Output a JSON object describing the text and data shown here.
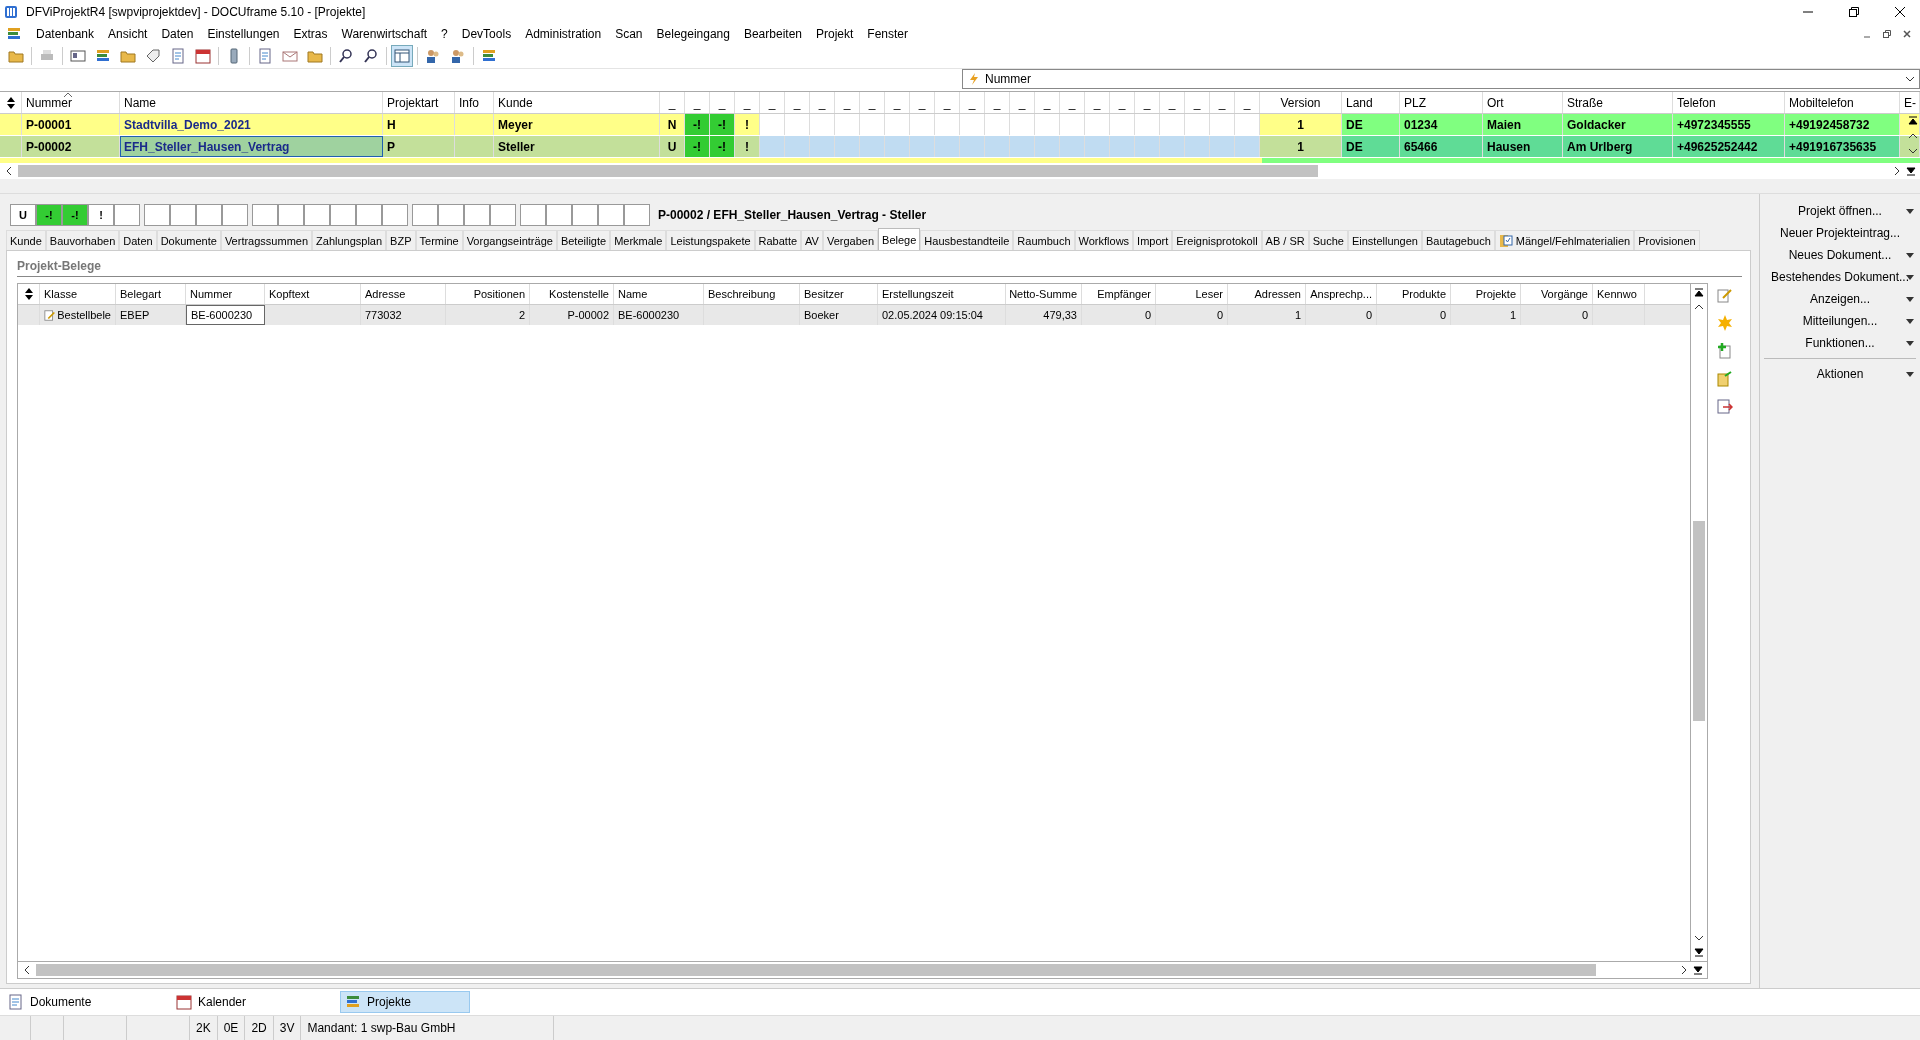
{
  "window": {
    "title": "DFViProjektR4 [swpviprojektdev] - DOCUframe 5.10 - [Projekte]"
  },
  "menu": [
    "Datenbank",
    "Ansicht",
    "Daten",
    "Einstellungen",
    "Extras",
    "Warenwirtschaft",
    "?",
    "DevTools",
    "Administration",
    "Scan",
    "Belegeingang",
    "Bearbeiten",
    "Projekt",
    "Fenster"
  ],
  "filter": {
    "value": "Nummer"
  },
  "projects": {
    "columns": [
      "Nummer",
      "Name",
      "Projektart",
      "Info",
      "Kunde",
      "Version",
      "Land",
      "PLZ",
      "Ort",
      "Straße",
      "Telefon",
      "Mobiltelefon",
      "E-"
    ],
    "flag_headers": [
      "_",
      "_",
      "_",
      "_",
      "_",
      "_",
      "_",
      "_",
      "_",
      "_",
      "_",
      "_",
      "_",
      "_",
      "_",
      "_",
      "_",
      "_",
      "_",
      "_",
      "_",
      "_",
      "_",
      "_"
    ],
    "rows": [
      {
        "selected": false,
        "nummer": "P-00001",
        "name": "Stadtvilla_Demo_2021",
        "projektart": "H",
        "info": null,
        "kunde": "Meyer",
        "flags": [
          {
            "text": "N",
            "color": "#ffff88"
          },
          {
            "text": "-!",
            "color": "#33cc33"
          },
          {
            "text": "-!",
            "color": "#33cc33"
          },
          {
            "text": "!",
            "color": "#ffff88"
          }
        ],
        "version": "1",
        "land": "DE",
        "plz": "01234",
        "ort": "Maien",
        "strasse": "Goldacker",
        "telefon": "+4972345555",
        "mobil": "+49192458732"
      },
      {
        "selected": true,
        "nummer": "P-00002",
        "name": "EFH_Steller_Hausen_Vertrag",
        "projektart": "P",
        "info": null,
        "kunde": "Steller",
        "flags": [
          {
            "text": "U",
            "color": "#c3e09a"
          },
          {
            "text": "-!",
            "color": "#33cc33"
          },
          {
            "text": "-!",
            "color": "#33cc33"
          },
          {
            "text": "!",
            "color": "#c3e09a"
          }
        ],
        "version": "1",
        "land": "DE",
        "plz": "65466",
        "ort": "Hausen",
        "strasse": "Am Urlberg",
        "telefon": "+49625252442",
        "mobil": "+491916735635"
      }
    ]
  },
  "detail": {
    "title": "P-00002 / EFH_Steller_Hausen_Vertrag - Steller",
    "status_boxes": [
      {
        "text": "U",
        "color": "#ffffff"
      },
      {
        "text": "-!",
        "color": "#33cc33"
      },
      {
        "text": "-!",
        "color": "#33cc33"
      },
      {
        "text": "!",
        "color": "#ffffff"
      }
    ],
    "tabs": [
      {
        "label": "Kunde",
        "selected": false
      },
      {
        "label": "Bauvorhaben",
        "selected": false
      },
      {
        "label": "Daten",
        "selected": false
      },
      {
        "label": "Dokumente",
        "selected": false
      },
      {
        "label": "Vertragssummen",
        "selected": false
      },
      {
        "label": "Zahlungsplan",
        "selected": false
      },
      {
        "label": "BZP",
        "selected": false
      },
      {
        "label": "Termine",
        "selected": false
      },
      {
        "label": "Vorgangseinträge",
        "selected": false
      },
      {
        "label": "Beteiligte",
        "selected": false
      },
      {
        "label": "Merkmale",
        "selected": false
      },
      {
        "label": "Leistungspakete",
        "selected": false
      },
      {
        "label": "Rabatte",
        "selected": false
      },
      {
        "label": "AV",
        "selected": false
      },
      {
        "label": "Vergaben",
        "selected": false
      },
      {
        "label": "Belege",
        "selected": true
      },
      {
        "label": "Hausbestandteile",
        "selected": false
      },
      {
        "label": "Raumbuch",
        "selected": false
      },
      {
        "label": "Workflows",
        "selected": false
      },
      {
        "label": "Import",
        "selected": false
      },
      {
        "label": "Ereignisprotokoll",
        "selected": false
      },
      {
        "label": "AB / SR",
        "selected": false
      },
      {
        "label": "Suche",
        "selected": false
      },
      {
        "label": "Einstellungen",
        "selected": false
      },
      {
        "label": "Bautagebuch",
        "selected": false
      },
      {
        "label": "Mängel/Fehlmaterialien",
        "selected": false,
        "kind": "icon"
      },
      {
        "label": "Provisionen",
        "selected": false
      }
    ],
    "section_title": "Projekt-Belege",
    "grid": {
      "columns": [
        "Klasse",
        "Belegart",
        "Nummer",
        "Kopftext",
        "Adresse",
        "Positionen",
        "Kostenstelle",
        "Name",
        "Beschreibung",
        "Besitzer",
        "Erstellungszeit",
        "Netto-Summe",
        "Empfänger",
        "Leser",
        "Adressen",
        "Ansprechp...",
        "Produkte",
        "Projekte",
        "Vorgänge",
        "Kennwo"
      ],
      "rows": [
        {
          "cells": [
            "Bestellbele",
            "EBEP",
            "BE-6000230",
            null,
            "773032",
            "2",
            "P-00002",
            "BE-6000230",
            null,
            "Boeker",
            "02.05.2024 09:15:04",
            "479,33",
            "0",
            "0",
            "1",
            "0",
            "0",
            "1",
            "0",
            null
          ]
        }
      ]
    }
  },
  "actions": [
    {
      "label": "Projekt öffnen...",
      "has_menu": true
    },
    {
      "label": "Neuer Projekteintrag...",
      "has_menu": false
    },
    {
      "label": "Neues Dokument...",
      "has_menu": true
    },
    {
      "label": "Bestehendes Dokument...",
      "has_menu": true
    },
    {
      "label": "Anzeigen...",
      "has_menu": true
    },
    {
      "label": "Mitteilungen...",
      "has_menu": true
    },
    {
      "label": "Funktionen...",
      "has_menu": true
    },
    {
      "label": "Aktionen",
      "has_menu": true,
      "kind": "separated"
    }
  ],
  "taskbar": [
    {
      "label": "Dokumente",
      "selected": false
    },
    {
      "label": "Kalender",
      "selected": false
    },
    {
      "label": "Projekte",
      "selected": true
    }
  ],
  "status_bar": [
    "2K",
    "0E",
    "2D",
    "3V",
    "Mandant: 1 swp-Bau GmbH"
  ]
}
